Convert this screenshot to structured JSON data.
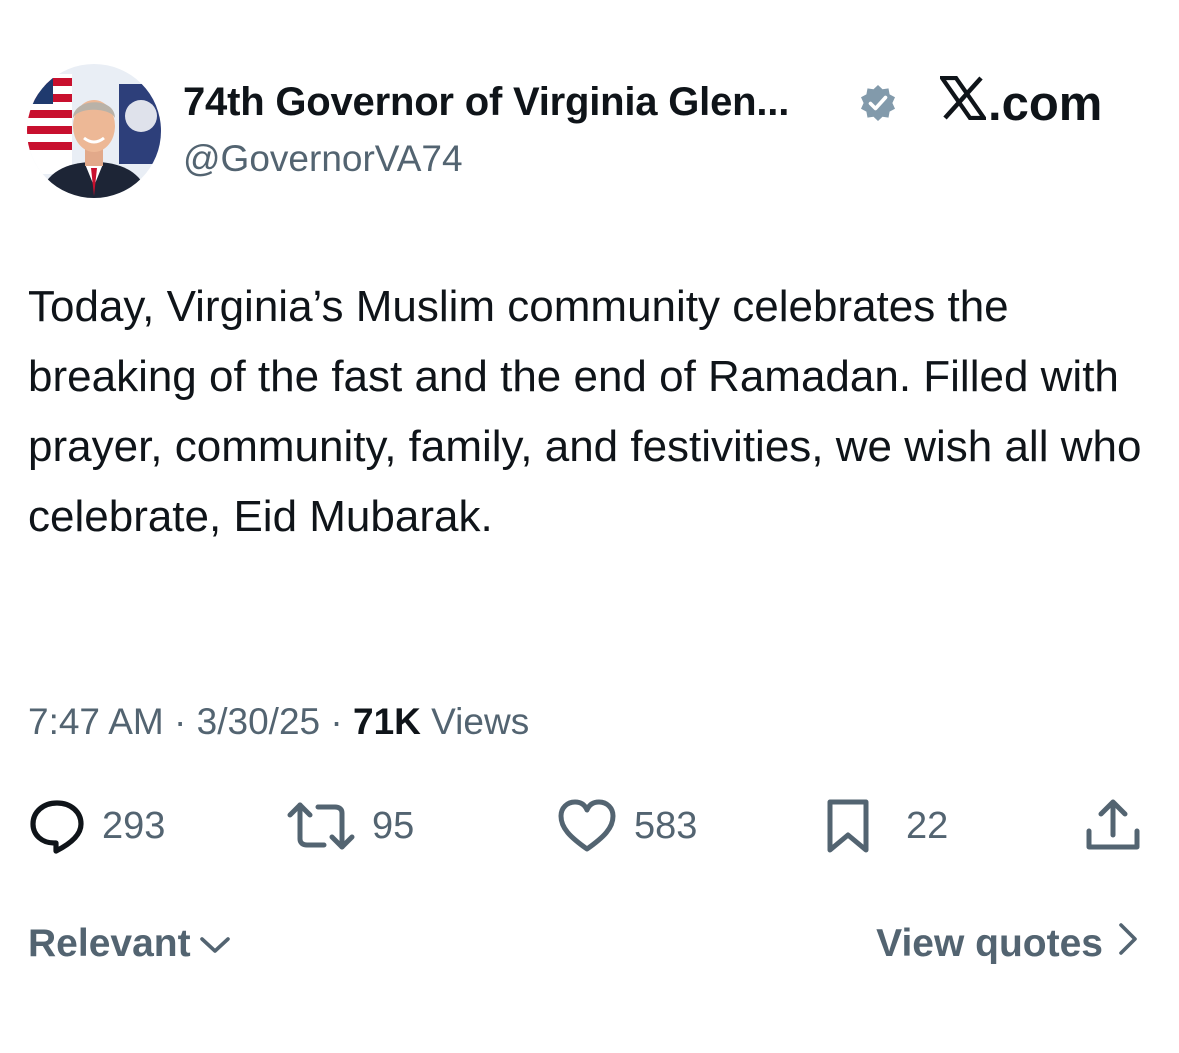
{
  "header": {
    "display_name": "74th Governor of Virginia Glen...",
    "handle": "@GovernorVA74",
    "brand": ".com",
    "brand_icon": "x-logo-icon",
    "verified_icon": "verified-badge-icon",
    "verified_color": "#829aab"
  },
  "post": {
    "text": "Today, Virginia’s Muslim community celebrates the breaking of the fast and the end of Ramadan. Filled with prayer, community, family, and festivities, we wish all who celebrate, Eid Mubarak."
  },
  "meta": {
    "time": "7:47 AM",
    "sep1": " · ",
    "date": "3/30/25",
    "sep2": " · ",
    "views_count": "71K",
    "views_label": " Views"
  },
  "actions": {
    "replies": "293",
    "reposts": "95",
    "likes": "583",
    "bookmarks": "22"
  },
  "footer": {
    "sort_label": "Relevant",
    "view_quotes_label": "View quotes"
  },
  "colors": {
    "text_primary": "#0f1419",
    "text_secondary": "#536471"
  }
}
